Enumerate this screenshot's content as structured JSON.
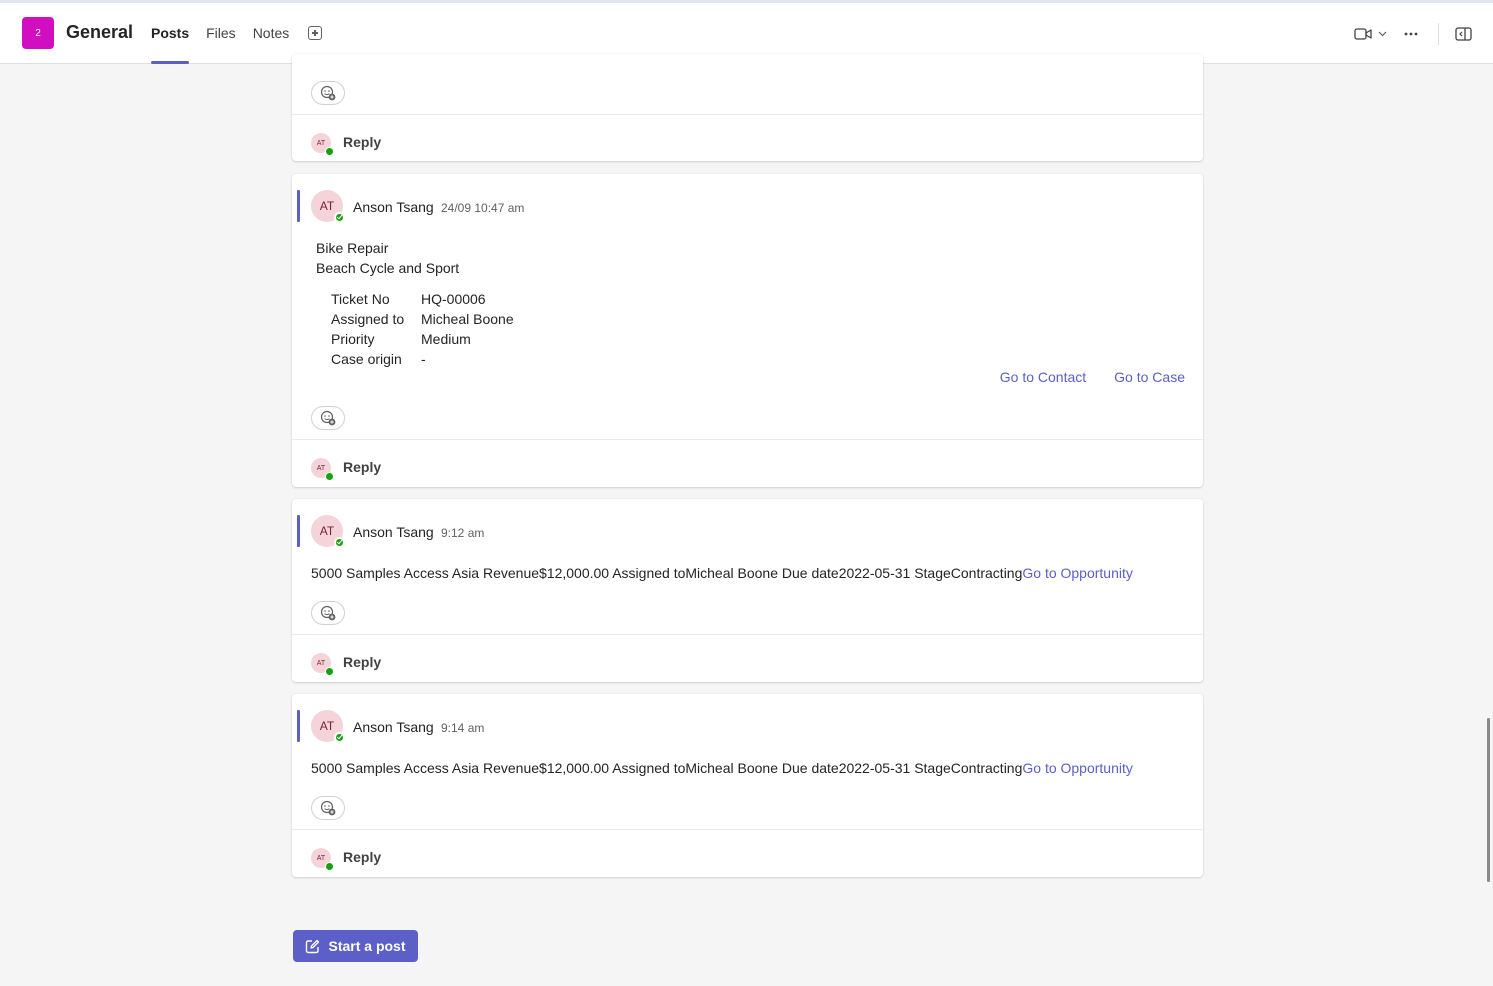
{
  "header": {
    "team_avatar_text": "2",
    "channel_title": "General",
    "tabs": [
      {
        "label": "Posts",
        "active": true
      },
      {
        "label": "Files",
        "active": false
      },
      {
        "label": "Notes",
        "active": false
      }
    ],
    "icons": {
      "add_tab": "add-tab-icon",
      "meet": "video-camera-icon",
      "meet_dropdown": "chevron-down-icon",
      "more": "more-options-icon",
      "panel": "open-pane-icon"
    },
    "accent_color": "#5b5fc7",
    "team_color": "#d20fc0"
  },
  "posts": [
    {
      "reply_label": "Reply",
      "reply_avatar_initials": "AT"
    },
    {
      "avatar_initials": "AT",
      "author": "Anson Tsang",
      "time": "24/09 10:47 am",
      "title": "Bike Repair",
      "subtitle": "Beach Cycle and Sport",
      "facts": [
        {
          "key": "Ticket No",
          "value": "HQ-00006"
        },
        {
          "key": "Assigned to",
          "value": "Micheal Boone"
        },
        {
          "key": "Priority",
          "value": "Medium"
        },
        {
          "key": "Case origin",
          "value": "-"
        }
      ],
      "actions": [
        "Go to Contact",
        "Go to Case"
      ],
      "reply_label": "Reply",
      "reply_avatar_initials": "AT"
    },
    {
      "avatar_initials": "AT",
      "author": "Anson Tsang",
      "time": "9:12 am",
      "text": "5000 Samples Access Asia Revenue$12,000.00 Assigned toMicheal Boone Due date2022-05-31 StageContracting",
      "link": "Go to Opportunity",
      "reply_label": "Reply",
      "reply_avatar_initials": "AT"
    },
    {
      "avatar_initials": "AT",
      "author": "Anson Tsang",
      "time": "9:14 am",
      "text": "5000 Samples Access Asia Revenue$12,000.00 Assigned toMicheal Boone Due date2022-05-31 StageContracting",
      "link": "Go to Opportunity",
      "reply_label": "Reply",
      "reply_avatar_initials": "AT"
    }
  ],
  "compose": {
    "start_post_label": "Start a post",
    "icon": "compose-icon"
  }
}
